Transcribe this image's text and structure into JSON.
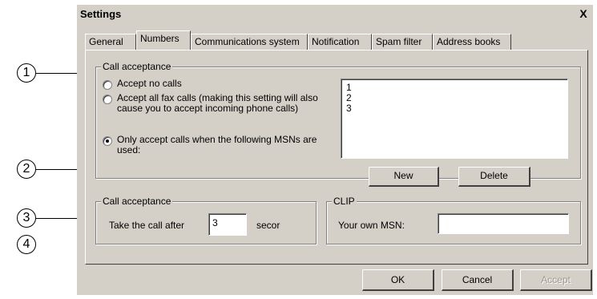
{
  "window": {
    "title": "Settings",
    "close_glyph": "X"
  },
  "tabs": [
    {
      "label": "General"
    },
    {
      "label": "Numbers"
    },
    {
      "label": "Communications system"
    },
    {
      "label": "Notification"
    },
    {
      "label": "Spam filter"
    },
    {
      "label": "Address books"
    }
  ],
  "call_acceptance_group": {
    "legend": "Call acceptance",
    "options": [
      {
        "label": "Accept no calls",
        "checked": false
      },
      {
        "label": "Accept all fax calls (making this setting will also cause you to accept incoming phone calls)",
        "checked": false
      },
      {
        "label": "Only accept calls when the following MSNs are used:",
        "checked": true
      }
    ],
    "msn_list": [
      "1",
      "2",
      "3"
    ],
    "new_button": "New",
    "delete_button": "Delete"
  },
  "timing_group": {
    "legend": "Call acceptance",
    "take_label": "Take the call after",
    "seconds_value": "3",
    "unit_label": "secor"
  },
  "clip_group": {
    "legend": "CLIP",
    "msn_label": "Your own MSN:",
    "msn_value": ""
  },
  "footer": {
    "ok": "OK",
    "cancel": "Cancel",
    "accept": "Accept"
  },
  "callouts": [
    "1",
    "2",
    "3",
    "4"
  ]
}
